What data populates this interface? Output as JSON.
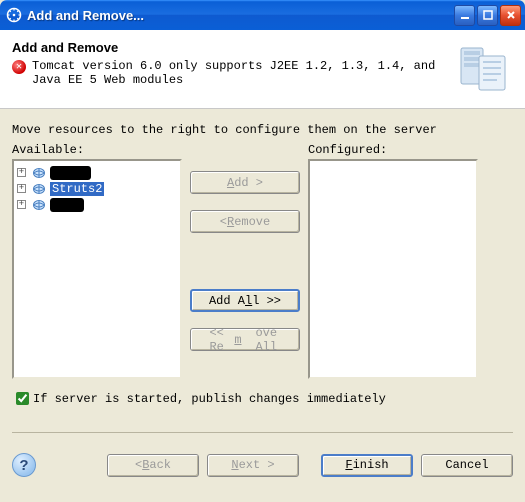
{
  "window": {
    "title": "Add and Remove..."
  },
  "header": {
    "title": "Add and Remove",
    "error_message": "Tomcat version 6.0 only supports J2EE 1.2, 1.3, 1.4, and Java EE 5 Web modules"
  },
  "body": {
    "instruction": "Move resources to the right to configure them on the server",
    "available_label": "Available:",
    "configured_label": "Configured:",
    "available_items": [
      {
        "label": "████",
        "selected": false,
        "redacted": true
      },
      {
        "label": "Struts2",
        "selected": true,
        "redacted": false
      },
      {
        "label": "███",
        "selected": false,
        "redacted": true
      }
    ],
    "configured_items": []
  },
  "buttons": {
    "add": "Add >",
    "remove": "< Remove",
    "add_all": "Add All >>",
    "remove_all": "<< Remove All"
  },
  "checkbox": {
    "label": "If server is started, publish changes immediately",
    "checked": true
  },
  "footer": {
    "back": "Back",
    "next": "Next",
    "finish": "Finish",
    "cancel": "Cancel"
  }
}
